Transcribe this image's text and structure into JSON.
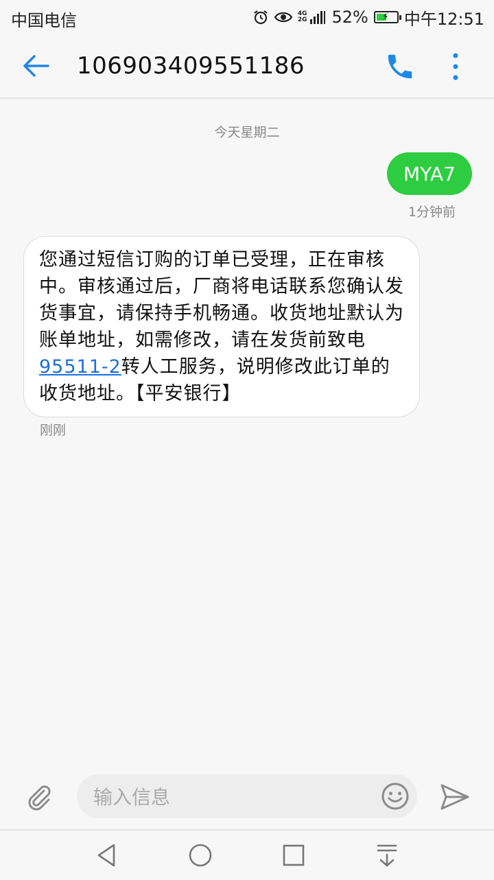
{
  "status_bar": {
    "carrier": "中国电信",
    "network_top": "4G",
    "network_bottom": "2G",
    "battery": "52%",
    "battery_level": 0.52,
    "time": "中午12:51"
  },
  "header": {
    "title": "106903409551186",
    "icons": {
      "back": "arrow-left-icon",
      "call": "phone-icon",
      "more": "more-vertical-icon"
    },
    "accent_color": "#1e88e5"
  },
  "conversation": {
    "date_separator": "今天星期二",
    "outgoing": {
      "text": "MYA7",
      "time": "1分钟前",
      "bubble_color": "#2ecc40"
    },
    "incoming": {
      "text_before_link": "您通过短信订购的订单已受理，正在审核中。审核通过后，厂商将电话联系您确认发货事宜，请保持手机畅通。收货地址默认为账单地址，如需修改，请在发货前致电",
      "link": "95511-2",
      "text_after_link": "转人工服务，说明修改此订单的收货地址。【平安银行】",
      "time": "刚刚"
    }
  },
  "composer": {
    "placeholder": "输入信息",
    "icons": {
      "attach": "paperclip-icon",
      "emoji": "smiley-icon",
      "send": "send-icon"
    }
  },
  "navbar": {
    "icons": [
      "back-triangle-icon",
      "home-circle-icon",
      "recents-square-icon",
      "notification-pull-icon"
    ]
  }
}
